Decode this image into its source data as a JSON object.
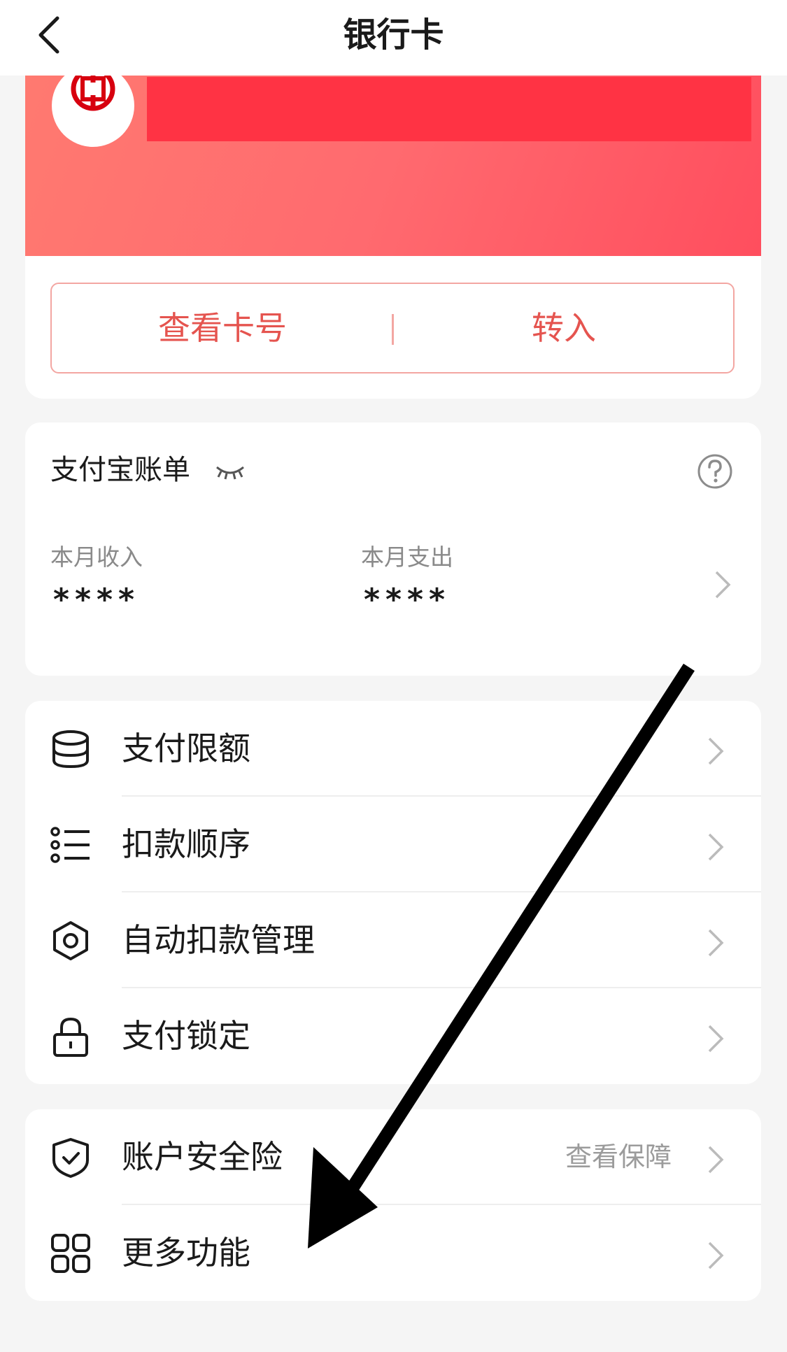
{
  "nav": {
    "title": "银行卡"
  },
  "card": {
    "view_number_label": "查看卡号",
    "transfer_in_label": "转入"
  },
  "bill": {
    "title": "支付宝账单",
    "income_label": "本月收入",
    "income_value": "****",
    "expense_label": "本月支出",
    "expense_value": "****"
  },
  "menu": {
    "items": [
      {
        "label": "支付限额",
        "icon": "database-icon"
      },
      {
        "label": "扣款顺序",
        "icon": "list-icon"
      },
      {
        "label": "自动扣款管理",
        "icon": "gear-icon"
      },
      {
        "label": "支付锁定",
        "icon": "lock-icon"
      }
    ]
  },
  "menu2": {
    "items": [
      {
        "label": "账户安全险",
        "aside": "查看保障",
        "icon": "shield-check-icon"
      },
      {
        "label": "更多功能",
        "icon": "grid-icon"
      }
    ]
  },
  "colors": {
    "accent": "#e5544f",
    "card_gradient_start": "#ff7a70",
    "card_gradient_end": "#ff4e5e",
    "redaction": "#ff3344"
  }
}
